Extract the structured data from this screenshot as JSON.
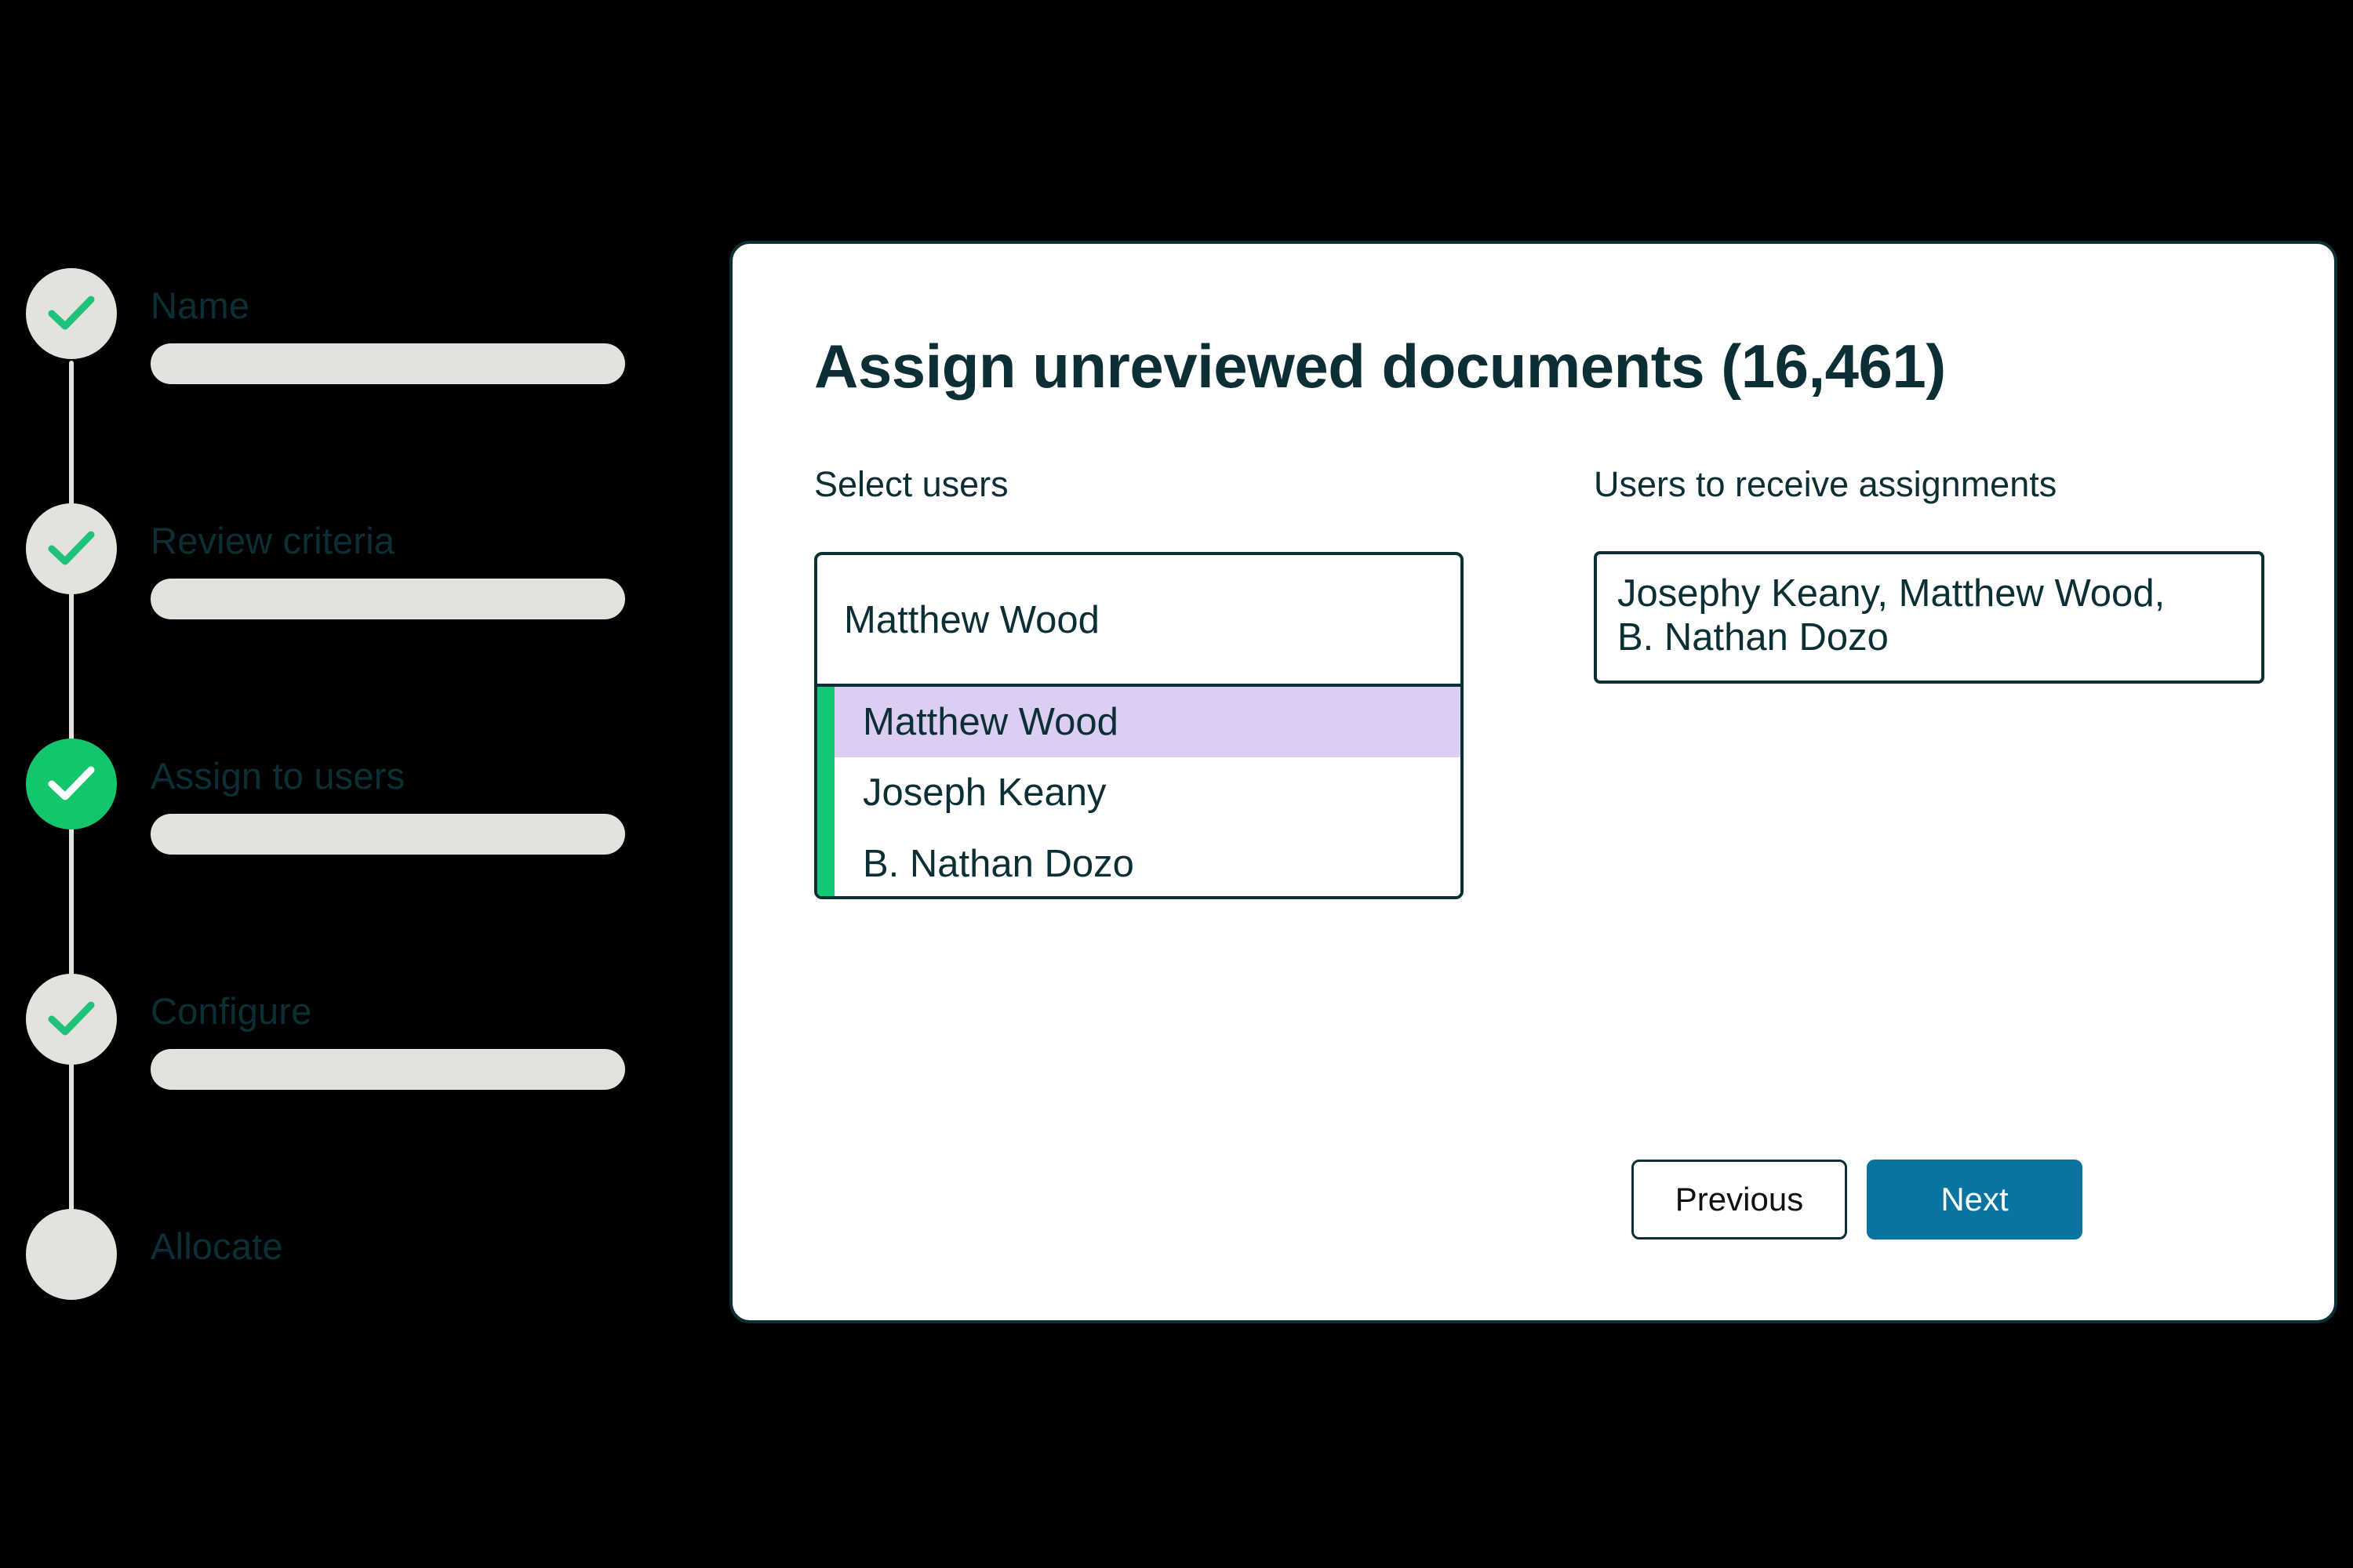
{
  "colors": {
    "background": "#000000",
    "panel_bg": "#ffffff",
    "border_dark": "#0b2f34",
    "text_dark": "#0b2f34",
    "step_idle": "#e3e2dd",
    "step_active": "#13c56b",
    "check_green": "#1ec27a",
    "check_active": "#ffffff",
    "accent_green": "#13c777",
    "highlight_lavender": "#dccef2",
    "next_button": "#0a74a0",
    "next_button_text": "#ffffff"
  },
  "stepper": {
    "steps": [
      {
        "label": "Name",
        "state": "complete",
        "icon": "check-icon",
        "has_bar": true
      },
      {
        "label": "Review criteria",
        "state": "complete",
        "icon": "check-icon",
        "has_bar": true
      },
      {
        "label": "Assign to users",
        "state": "active",
        "icon": "check-icon-white",
        "has_bar": true
      },
      {
        "label": "Configure",
        "state": "complete",
        "icon": "check-icon",
        "has_bar": true
      },
      {
        "label": "Allocate",
        "state": "pending",
        "icon": "",
        "has_bar": false
      }
    ]
  },
  "panel": {
    "title": "Assign unreviewed documents (16,461)",
    "select_users": {
      "label": "Select users",
      "input_value": "Matthew Wood",
      "placeholder": "Matthew Wood",
      "options": [
        {
          "label": "Matthew Wood",
          "highlighted": true
        },
        {
          "label": "Joseph Keany",
          "highlighted": false
        },
        {
          "label": "B. Nathan Dozo",
          "highlighted": false
        }
      ]
    },
    "assignments": {
      "label": "Users to receive assignments",
      "lines": [
        "Josephy Keany, Matthew Wood,",
        "B. Nathan Dozo"
      ]
    },
    "footer": {
      "previous_label": "Previous",
      "next_label": "Next"
    }
  }
}
